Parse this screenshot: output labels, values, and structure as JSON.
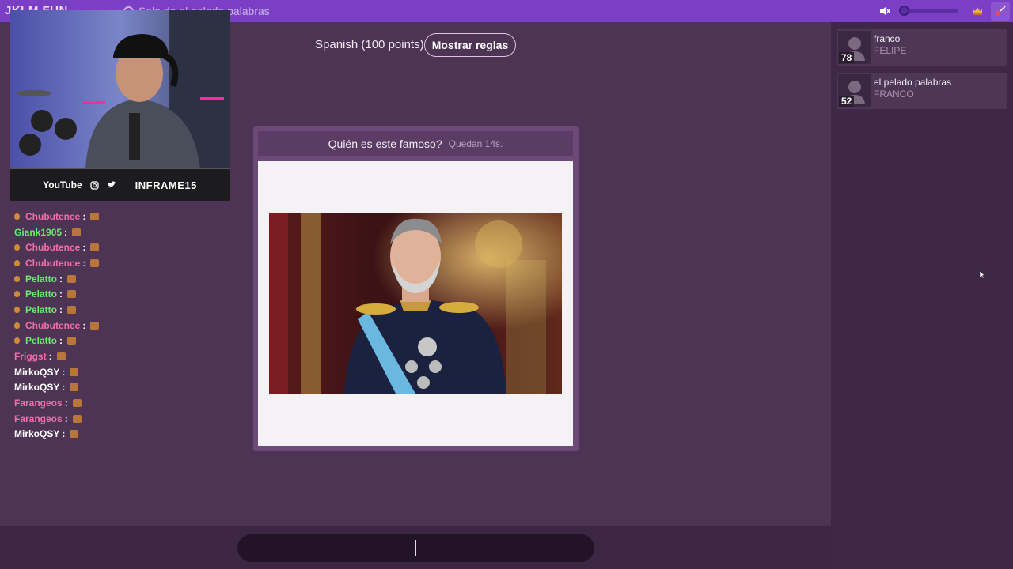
{
  "topbar": {
    "app_title": "JKLM.FUN",
    "room_title": "Sala de el pelado palabras",
    "icons": [
      "mute-icon",
      "crown-icon",
      "exit-icon"
    ],
    "volume_level": 0.05
  },
  "game": {
    "language": "Spanish (100 points)",
    "rules_button": "Mostrar reglas",
    "question": "Quién es este famoso?",
    "timer": "Quedan 14s."
  },
  "webcam": {
    "youtube_label": "YouTube",
    "handle": "INFRAME15",
    "icons": [
      "instagram-icon",
      "twitter-icon"
    ]
  },
  "chat": {
    "messages": [
      {
        "user": "Chubutence",
        "color": "pink",
        "badge": true
      },
      {
        "user": "Giank1905",
        "color": "green",
        "badge": false
      },
      {
        "user": "Chubutence",
        "color": "pink",
        "badge": true
      },
      {
        "user": "Chubutence",
        "color": "pink",
        "badge": true
      },
      {
        "user": "Pelatto",
        "color": "green",
        "badge": true
      },
      {
        "user": "Pelatto",
        "color": "green",
        "badge": true
      },
      {
        "user": "Pelatto",
        "color": "green",
        "badge": true
      },
      {
        "user": "Chubutence",
        "color": "pink",
        "badge": true
      },
      {
        "user": "Pelatto",
        "color": "green",
        "badge": true
      },
      {
        "user": "Friggst",
        "color": "pink",
        "badge": false
      },
      {
        "user": "MirkoQSY",
        "color": "white",
        "badge": false
      },
      {
        "user": "MirkoQSY",
        "color": "white",
        "badge": false
      },
      {
        "user": "Farangeos",
        "color": "pink",
        "badge": false
      },
      {
        "user": "Farangeos",
        "color": "pink",
        "badge": false
      },
      {
        "user": "MirkoQSY",
        "color": "white",
        "badge": false
      }
    ],
    "separator": ":"
  },
  "players": [
    {
      "name": "franco",
      "guess": "FELIPE",
      "score": "78"
    },
    {
      "name": "el pelado palabras",
      "guess": "FRANCO",
      "score": "52"
    }
  ],
  "colors": {
    "topbar": "#7a3fc4",
    "background": "#4d3354",
    "panel": "#3f2847",
    "accent_green": "#6de873",
    "accent_pink": "#f16ea8"
  }
}
